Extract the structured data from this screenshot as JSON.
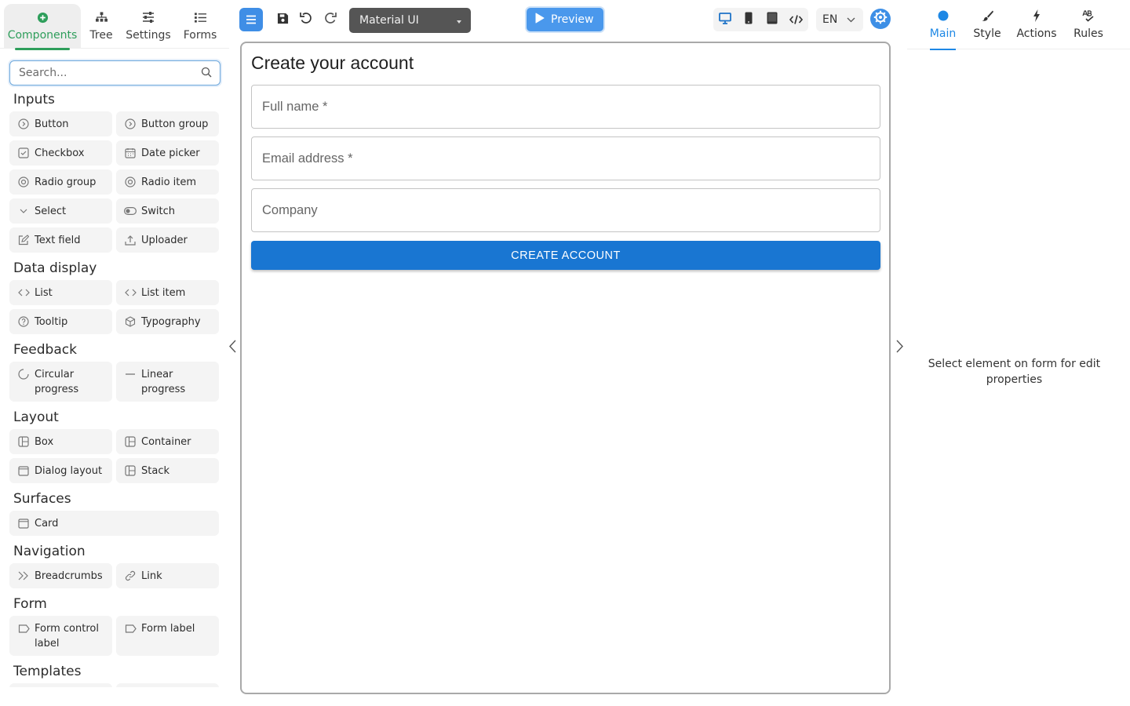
{
  "left_tabs": [
    {
      "label": "Components",
      "icon": "plus-circle-icon",
      "active": true
    },
    {
      "label": "Tree",
      "icon": "tree-icon",
      "active": false
    },
    {
      "label": "Settings",
      "icon": "sliders-icon",
      "active": false
    },
    {
      "label": "Forms",
      "icon": "list-icon",
      "active": false
    }
  ],
  "search": {
    "placeholder": "Search...",
    "value": ""
  },
  "palette": {
    "inputs": {
      "title": "Inputs",
      "items": [
        "Button",
        "Button group",
        "Checkbox",
        "Date picker",
        "Radio group",
        "Radio item",
        "Select",
        "Switch",
        "Text field",
        "Uploader"
      ]
    },
    "data_display": {
      "title": "Data display",
      "items": [
        "List",
        "List item",
        "Tooltip",
        "Typography"
      ]
    },
    "feedback": {
      "title": "Feedback",
      "items": [
        "Circular progress",
        "Linear progress"
      ]
    },
    "layout": {
      "title": "Layout",
      "items": [
        "Box",
        "Container",
        "Dialog layout",
        "Stack"
      ]
    },
    "surfaces": {
      "title": "Surfaces",
      "items": [
        "Card"
      ]
    },
    "navigation": {
      "title": "Navigation",
      "items": [
        "Breadcrumbs",
        "Link"
      ]
    },
    "form": {
      "title": "Form",
      "items": [
        "Form control label",
        "Form label"
      ]
    },
    "templates": {
      "title": "Templates",
      "items": []
    }
  },
  "toolbar": {
    "theme": "Material UI",
    "preview_label": "Preview",
    "language": "EN"
  },
  "form": {
    "title": "Create your account",
    "fields": [
      {
        "label": "Full name *"
      },
      {
        "label": "Email address *"
      },
      {
        "label": "Company"
      }
    ],
    "submit_label": "CREATE ACCOUNT"
  },
  "right_tabs": [
    {
      "label": "Main",
      "icon": "circle-icon",
      "active": true
    },
    {
      "label": "Style",
      "icon": "brush-icon",
      "active": false
    },
    {
      "label": "Actions",
      "icon": "lightning-icon",
      "active": false
    },
    {
      "label": "Rules",
      "icon": "spellcheck-icon",
      "active": false
    }
  ],
  "properties": {
    "empty_message": "Select element on form for edit properties"
  },
  "colors": {
    "accent": "#1976d2",
    "components_tab": "#2e9e5b",
    "preview": "#4a98ec",
    "theme_select": "#555555"
  }
}
